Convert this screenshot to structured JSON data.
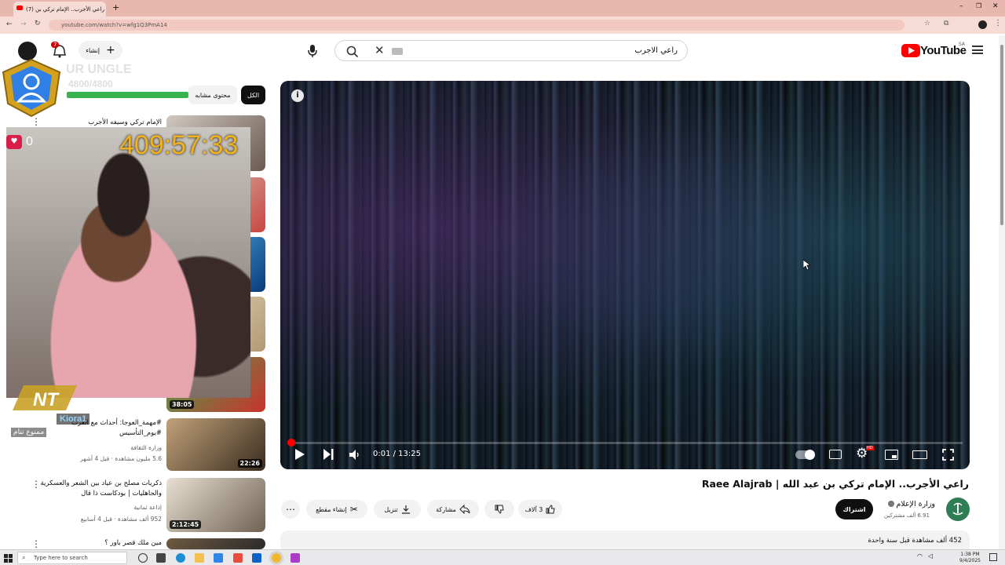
{
  "browser": {
    "tab_title": "(7) راعي الأجرب.. الإمام تركي بن",
    "url": "youtube.com/watch?v=wfg1Q3PmA14"
  },
  "header": {
    "logo_text": "YouTube",
    "region": "SA",
    "search_query": "راعي الاجرب",
    "create_label": "إنشاء",
    "notification_count": "7"
  },
  "player": {
    "current_time": "0:01",
    "duration": "13:25",
    "time_display": "0:01 / 13:25",
    "progress_fraction": 0.0012,
    "settings_badge": "HD"
  },
  "video": {
    "title": "راعي الأجرب.. الإمام تركي بن عبد الله | Raee Alajrab",
    "channel_name": "وزارة الإعلام",
    "channel_subs": "6.91 ألف مشتركين",
    "subscribe_label": "اشتراك",
    "like_count": "3 آلاف",
    "share_label": "مشاركة",
    "download_label": "تنزيل",
    "clip_label": "إنشاء مقطع",
    "description_meta": "452 ألف مشاهدة  قبل سنة واحدة"
  },
  "sidebar": {
    "chips": [
      "الكل",
      "محتوى مشابه"
    ],
    "recommendations": [
      {
        "title": "الإمام تركي وسيفه الأجرب",
        "meta": "",
        "duration": ""
      },
      {
        "title": "#مهمة_العوجا: أحداث مع العرب #يوم_التأسيس",
        "meta": "5.6 مليون مشاهدة · قبل 4 أشهر",
        "channel": "وزارة الثقافة",
        "duration": "22:26"
      },
      {
        "title": "ذكريات مصلح بن عياد بين الشعر والعسكرية والجاهليات | بودكاست ذا قال",
        "meta": "952 ألف مشاهدة · قبل 4 أسابيع",
        "channel": "إذاعة ثمانية",
        "duration": "2:12:45"
      },
      {
        "title": "مين ملك قصر باور ؟",
        "meta": "",
        "duration": ""
      }
    ],
    "overlay_duration": "38:05"
  },
  "stream_overlay": {
    "username": "UR UNGLE",
    "xp": "4800/4800",
    "counter": "0",
    "timer": "409:57:33",
    "viewer_name": "Kiora1",
    "status_text": "ممنوع تنام"
  },
  "taskbar": {
    "search_placeholder": "Type here to search",
    "time": "1:38 PM",
    "date": "9/4/2025"
  },
  "colors": {
    "youtube_red": "#ff0000",
    "timer_gold": "#f2b21c",
    "xp_green": "#36b34a",
    "tab_strip": "#e8b7ae"
  }
}
